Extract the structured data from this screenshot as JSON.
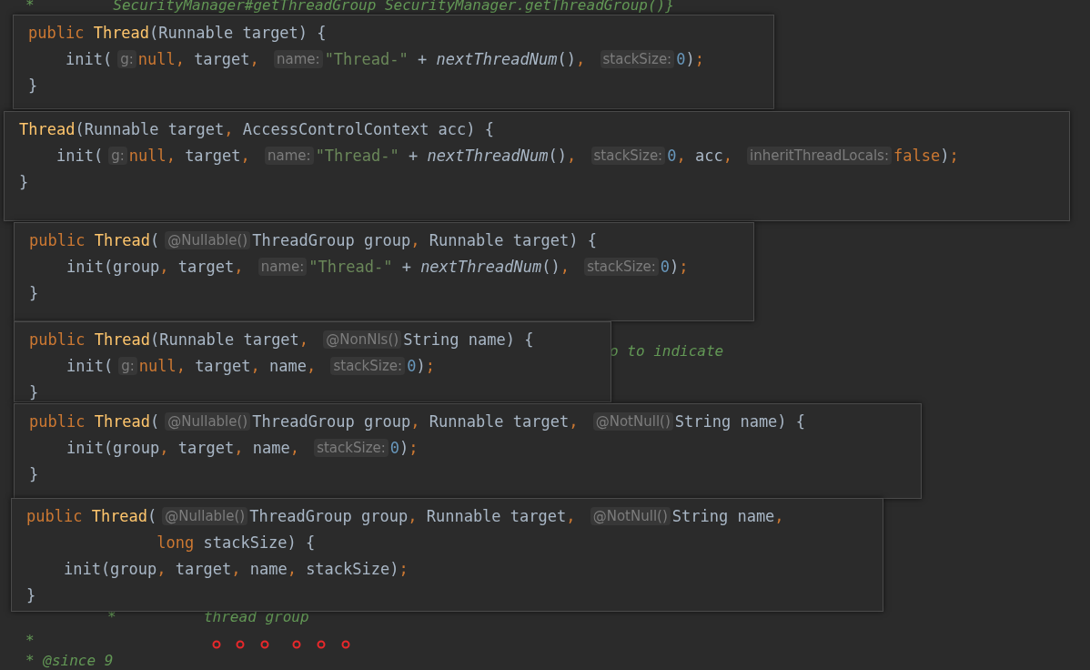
{
  "editor": {
    "lines": [
      {
        "kind": "comment",
        "text": "*         SecurityManager#getThreadGroup SecurityManager.getThreadGroup()}"
      },
      {
        "kind": "comment",
        "text": "o to indicate"
      },
      {
        "kind": "comment",
        "text": "*          thread group"
      },
      {
        "kind": "comment",
        "text": "*"
      },
      {
        "kind": "comment",
        "text": "* @since 9"
      }
    ]
  },
  "popups": [
    {
      "lines": [
        [
          {
            "kind": "keyword",
            "text": "public "
          },
          {
            "kind": "decl",
            "text": "Thread"
          },
          {
            "kind": "plain",
            "text": "(Runnable target) {"
          }
        ],
        [
          {
            "kind": "plain",
            "text": "    init("
          },
          {
            "kind": "hint",
            "text": "g:"
          },
          {
            "kind": "keyword",
            "text": "null, "
          },
          {
            "kind": "plain",
            "text": "target"
          },
          {
            "kind": "keyword",
            "text": ", "
          },
          {
            "kind": "hint",
            "text": "name:"
          },
          {
            "kind": "string",
            "text": "\"Thread-\""
          },
          {
            "kind": "plain",
            "text": " + "
          },
          {
            "kind": "method",
            "text": "nextThreadNum"
          },
          {
            "kind": "plain",
            "text": "()"
          },
          {
            "kind": "keyword",
            "text": ", "
          },
          {
            "kind": "hint",
            "text": "stackSize:"
          },
          {
            "kind": "number",
            "text": "0"
          },
          {
            "kind": "plain",
            "text": ")"
          },
          {
            "kind": "keyword",
            "text": ";"
          }
        ],
        [
          {
            "kind": "plain",
            "text": "}"
          }
        ]
      ]
    },
    {
      "lines": [
        [
          {
            "kind": "decl",
            "text": "Thread"
          },
          {
            "kind": "plain",
            "text": "(Runnable target"
          },
          {
            "kind": "keyword",
            "text": ", "
          },
          {
            "kind": "plain",
            "text": "AccessControlContext acc) {"
          }
        ],
        [
          {
            "kind": "plain",
            "text": "    init("
          },
          {
            "kind": "hint",
            "text": "g:"
          },
          {
            "kind": "keyword",
            "text": "null, "
          },
          {
            "kind": "plain",
            "text": "target"
          },
          {
            "kind": "keyword",
            "text": ", "
          },
          {
            "kind": "hint",
            "text": "name:"
          },
          {
            "kind": "string",
            "text": "\"Thread-\""
          },
          {
            "kind": "plain",
            "text": " + "
          },
          {
            "kind": "method",
            "text": "nextThreadNum"
          },
          {
            "kind": "plain",
            "text": "()"
          },
          {
            "kind": "keyword",
            "text": ", "
          },
          {
            "kind": "hint",
            "text": "stackSize:"
          },
          {
            "kind": "number",
            "text": "0"
          },
          {
            "kind": "keyword",
            "text": ", "
          },
          {
            "kind": "plain",
            "text": "acc"
          },
          {
            "kind": "keyword",
            "text": ", "
          },
          {
            "kind": "hint",
            "text": "inheritThreadLocals:"
          },
          {
            "kind": "keyword",
            "text": "false"
          },
          {
            "kind": "plain",
            "text": ")"
          },
          {
            "kind": "keyword",
            "text": ";"
          }
        ],
        [
          {
            "kind": "plain",
            "text": "}"
          }
        ]
      ]
    },
    {
      "lines": [
        [
          {
            "kind": "keyword",
            "text": "public "
          },
          {
            "kind": "decl",
            "text": "Thread"
          },
          {
            "kind": "plain",
            "text": "("
          },
          {
            "kind": "hint",
            "text": "@Nullable()"
          },
          {
            "kind": "plain",
            "text": "ThreadGroup group"
          },
          {
            "kind": "keyword",
            "text": ", "
          },
          {
            "kind": "plain",
            "text": "Runnable target) {"
          }
        ],
        [
          {
            "kind": "plain",
            "text": "    init(group"
          },
          {
            "kind": "keyword",
            "text": ", "
          },
          {
            "kind": "plain",
            "text": "target"
          },
          {
            "kind": "keyword",
            "text": ", "
          },
          {
            "kind": "hint",
            "text": "name:"
          },
          {
            "kind": "string",
            "text": "\"Thread-\""
          },
          {
            "kind": "plain",
            "text": " + "
          },
          {
            "kind": "method",
            "text": "nextThreadNum"
          },
          {
            "kind": "plain",
            "text": "()"
          },
          {
            "kind": "keyword",
            "text": ", "
          },
          {
            "kind": "hint",
            "text": "stackSize:"
          },
          {
            "kind": "number",
            "text": "0"
          },
          {
            "kind": "plain",
            "text": ")"
          },
          {
            "kind": "keyword",
            "text": ";"
          }
        ],
        [
          {
            "kind": "plain",
            "text": "}"
          }
        ]
      ]
    },
    {
      "lines": [
        [
          {
            "kind": "keyword",
            "text": "public "
          },
          {
            "kind": "decl",
            "text": "Thread"
          },
          {
            "kind": "plain",
            "text": "(Runnable target"
          },
          {
            "kind": "keyword",
            "text": ", "
          },
          {
            "kind": "hint",
            "text": "@NonNls()"
          },
          {
            "kind": "plain",
            "text": "String name) {"
          }
        ],
        [
          {
            "kind": "plain",
            "text": "    init("
          },
          {
            "kind": "hint",
            "text": "g:"
          },
          {
            "kind": "keyword",
            "text": "null, "
          },
          {
            "kind": "plain",
            "text": "target"
          },
          {
            "kind": "keyword",
            "text": ", "
          },
          {
            "kind": "plain",
            "text": "name"
          },
          {
            "kind": "keyword",
            "text": ", "
          },
          {
            "kind": "hint",
            "text": "stackSize:"
          },
          {
            "kind": "number",
            "text": "0"
          },
          {
            "kind": "plain",
            "text": ")"
          },
          {
            "kind": "keyword",
            "text": ";"
          }
        ],
        [
          {
            "kind": "plain",
            "text": "}"
          }
        ]
      ]
    },
    {
      "lines": [
        [
          {
            "kind": "keyword",
            "text": "public "
          },
          {
            "kind": "decl",
            "text": "Thread"
          },
          {
            "kind": "plain",
            "text": "("
          },
          {
            "kind": "hint",
            "text": "@Nullable()"
          },
          {
            "kind": "plain",
            "text": "ThreadGroup group"
          },
          {
            "kind": "keyword",
            "text": ", "
          },
          {
            "kind": "plain",
            "text": "Runnable target"
          },
          {
            "kind": "keyword",
            "text": ", "
          },
          {
            "kind": "hint",
            "text": "@NotNull()"
          },
          {
            "kind": "plain",
            "text": "String name) {"
          }
        ],
        [
          {
            "kind": "plain",
            "text": "    init(group"
          },
          {
            "kind": "keyword",
            "text": ", "
          },
          {
            "kind": "plain",
            "text": "target"
          },
          {
            "kind": "keyword",
            "text": ", "
          },
          {
            "kind": "plain",
            "text": "name"
          },
          {
            "kind": "keyword",
            "text": ", "
          },
          {
            "kind": "hint",
            "text": "stackSize:"
          },
          {
            "kind": "number",
            "text": "0"
          },
          {
            "kind": "plain",
            "text": ")"
          },
          {
            "kind": "keyword",
            "text": ";"
          }
        ],
        [
          {
            "kind": "plain",
            "text": "}"
          }
        ]
      ]
    },
    {
      "lines": [
        [
          {
            "kind": "keyword",
            "text": "public "
          },
          {
            "kind": "decl",
            "text": "Thread"
          },
          {
            "kind": "plain",
            "text": "("
          },
          {
            "kind": "hint",
            "text": "@Nullable()"
          },
          {
            "kind": "plain",
            "text": "ThreadGroup group"
          },
          {
            "kind": "keyword",
            "text": ", "
          },
          {
            "kind": "plain",
            "text": "Runnable target"
          },
          {
            "kind": "keyword",
            "text": ", "
          },
          {
            "kind": "hint",
            "text": "@NotNull()"
          },
          {
            "kind": "plain",
            "text": "String name"
          },
          {
            "kind": "keyword",
            "text": ","
          }
        ],
        [
          {
            "kind": "keyword",
            "text": "              long "
          },
          {
            "kind": "plain",
            "text": "stackSize) {"
          }
        ],
        [
          {
            "kind": "plain",
            "text": "    init(group"
          },
          {
            "kind": "keyword",
            "text": ", "
          },
          {
            "kind": "plain",
            "text": "target"
          },
          {
            "kind": "keyword",
            "text": ", "
          },
          {
            "kind": "plain",
            "text": "name"
          },
          {
            "kind": "keyword",
            "text": ", "
          },
          {
            "kind": "plain",
            "text": "stackSize)"
          },
          {
            "kind": "keyword",
            "text": ";"
          }
        ],
        [
          {
            "kind": "plain",
            "text": "}"
          }
        ]
      ]
    }
  ]
}
